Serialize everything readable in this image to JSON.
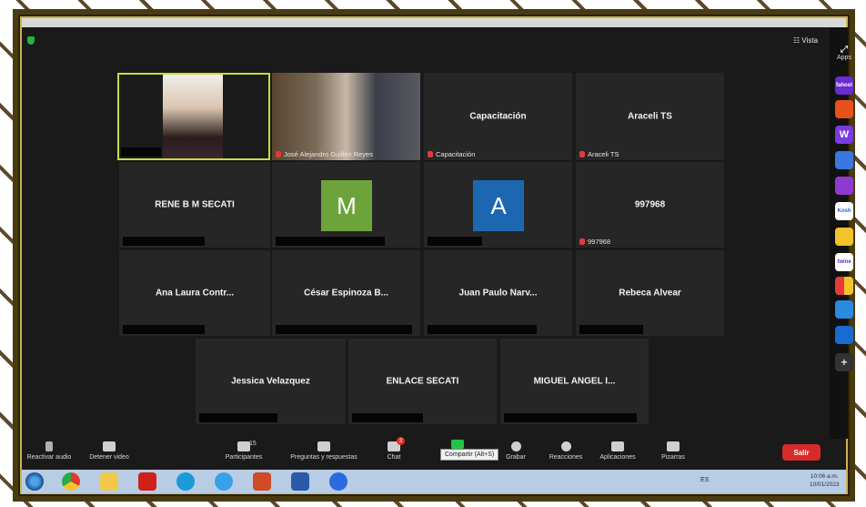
{
  "header": {
    "view_label": "Vista"
  },
  "sidebar": {
    "apps_label": "Apps",
    "icons": [
      "fahost-app-icon",
      "orange-app-icon",
      "w-app-icon",
      "blue-circle-app-icon",
      "purple-app-icon",
      "kinsh-app-icon",
      "emoji-app-icon",
      "twine-app-icon",
      "colorful-grid-app-icon",
      "sync-app-icon",
      "s-app-icon",
      "add-app-icon"
    ],
    "icon_labels": [
      "fahost",
      "",
      "W",
      "",
      "",
      "Kosh",
      "",
      "twine",
      "",
      "",
      "",
      ""
    ]
  },
  "tiles": [
    {
      "name": "",
      "label": "",
      "kind": "video"
    },
    {
      "name": "",
      "label": "José Alejandro Guillén Reyes",
      "kind": "video"
    },
    {
      "name": "Capacitación",
      "label": "Capacitación",
      "kind": "text"
    },
    {
      "name": "Araceli TS",
      "label": "Araceli TS",
      "kind": "text"
    },
    {
      "name": "RENE B M SECATI",
      "label": "",
      "kind": "text"
    },
    {
      "name": "M",
      "label": "",
      "kind": "avatar",
      "color": "#6ca43b"
    },
    {
      "name": "A",
      "label": "",
      "kind": "avatar",
      "color": "#1d67b0"
    },
    {
      "name": "997968",
      "label": "997968",
      "kind": "text"
    },
    {
      "name": "Ana Laura Contr...",
      "label": "",
      "kind": "text"
    },
    {
      "name": "César Espinoza B...",
      "label": "",
      "kind": "text"
    },
    {
      "name": "Juan Paulo Narv...",
      "label": "",
      "kind": "text"
    },
    {
      "name": "Rebeca Alvear",
      "label": "",
      "kind": "text"
    },
    {
      "name": "Jessica Velazquez",
      "label": "",
      "kind": "text"
    },
    {
      "name": "ENLACE SECATI",
      "label": "",
      "kind": "text"
    },
    {
      "name": "MIGUEL ANGEL I...",
      "label": "",
      "kind": "text"
    }
  ],
  "toolbar": {
    "unmute": "Reactivar audio",
    "stop_video": "Detener video",
    "participants": "Participantes",
    "participants_count": "15",
    "qa": "Preguntas y respuestas",
    "chat": "Chat",
    "chat_badge": "3",
    "share_tooltip": "Compartir (Alt+S)",
    "record": "Grabar",
    "reactions": "Reacciones",
    "apps": "Aplicaciones",
    "whiteboards": "Pizarras",
    "leave": "Salir"
  },
  "taskbar": {
    "tray": "ES",
    "time": "10:06 a.m.",
    "date": "10/01/2023"
  },
  "colors": {
    "leave_red": "#d62b2b",
    "active_speaker": "#c8dc3c",
    "muted_red": "#e03a3a"
  }
}
